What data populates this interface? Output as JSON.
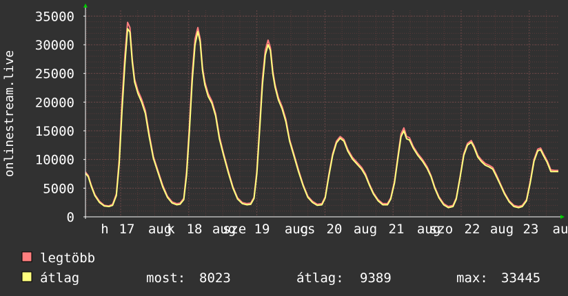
{
  "chart_data": {
    "type": "line",
    "ylabel": "onlinestream.live",
    "ylim": [
      0,
      36000
    ],
    "y_ticks": [
      0,
      5000,
      10000,
      15000,
      20000,
      25000,
      30000,
      35000
    ],
    "x_tick_labels": [
      "h",
      "17",
      "aug",
      "k",
      "18",
      "aug",
      "sze",
      "19",
      "aug",
      "cs",
      "20",
      "aug",
      "21",
      "aug",
      "szo",
      "22",
      "aug",
      "23",
      "au"
    ],
    "grid": true,
    "colors": {
      "background": "#313131",
      "plot_background": "#313131",
      "grid_minor": "#5a3a3a",
      "grid_major": "#6a4848",
      "axis": "#ffffff",
      "arrow": "#00cc00",
      "max_series": "#ff7f7f",
      "avg_series": "#ffff7f"
    },
    "series": [
      {
        "name": "legtöbb",
        "points": [
          [
            0,
            7800
          ],
          [
            0.06,
            7200
          ],
          [
            0.12,
            5600
          ],
          [
            0.2,
            3900
          ],
          [
            0.3,
            2700
          ],
          [
            0.4,
            2000
          ],
          [
            0.5,
            1900
          ],
          [
            0.58,
            2200
          ],
          [
            0.66,
            4000
          ],
          [
            0.72,
            10000
          ],
          [
            0.78,
            20000
          ],
          [
            0.84,
            28000
          ],
          [
            0.9,
            33900
          ],
          [
            0.95,
            33000
          ],
          [
            1.0,
            27500
          ],
          [
            1.05,
            24000
          ],
          [
            1.12,
            22000
          ],
          [
            1.2,
            20500
          ],
          [
            1.28,
            18500
          ],
          [
            1.36,
            14500
          ],
          [
            1.45,
            10500
          ],
          [
            1.55,
            8000
          ],
          [
            1.65,
            5500
          ],
          [
            1.75,
            3600
          ],
          [
            1.85,
            2600
          ],
          [
            1.95,
            2300
          ],
          [
            2.02,
            2400
          ],
          [
            2.1,
            3200
          ],
          [
            2.16,
            8000
          ],
          [
            2.22,
            16000
          ],
          [
            2.28,
            25000
          ],
          [
            2.34,
            31000
          ],
          [
            2.4,
            33000
          ],
          [
            2.45,
            31000
          ],
          [
            2.5,
            26000
          ],
          [
            2.55,
            23500
          ],
          [
            2.62,
            21500
          ],
          [
            2.7,
            20200
          ],
          [
            2.78,
            18000
          ],
          [
            2.86,
            14000
          ],
          [
            2.95,
            11000
          ],
          [
            3.05,
            8000
          ],
          [
            3.15,
            5200
          ],
          [
            3.25,
            3300
          ],
          [
            3.35,
            2500
          ],
          [
            3.45,
            2300
          ],
          [
            3.53,
            2400
          ],
          [
            3.6,
            3400
          ],
          [
            3.66,
            8000
          ],
          [
            3.72,
            16000
          ],
          [
            3.78,
            24000
          ],
          [
            3.84,
            29000
          ],
          [
            3.9,
            30800
          ],
          [
            3.95,
            29500
          ],
          [
            4.0,
            25500
          ],
          [
            4.05,
            23000
          ],
          [
            4.12,
            20800
          ],
          [
            4.2,
            19200
          ],
          [
            4.28,
            17000
          ],
          [
            4.36,
            13500
          ],
          [
            4.45,
            11000
          ],
          [
            4.55,
            8200
          ],
          [
            4.65,
            5600
          ],
          [
            4.75,
            3600
          ],
          [
            4.85,
            2700
          ],
          [
            4.95,
            2200
          ],
          [
            5.05,
            2300
          ],
          [
            5.12,
            3500
          ],
          [
            5.2,
            7500
          ],
          [
            5.28,
            11000
          ],
          [
            5.36,
            13200
          ],
          [
            5.44,
            14000
          ],
          [
            5.52,
            13500
          ],
          [
            5.6,
            11800
          ],
          [
            5.7,
            10400
          ],
          [
            5.8,
            9500
          ],
          [
            5.9,
            8600
          ],
          [
            5.98,
            7500
          ],
          [
            6.06,
            5800
          ],
          [
            6.15,
            4200
          ],
          [
            6.25,
            3000
          ],
          [
            6.35,
            2300
          ],
          [
            6.45,
            2300
          ],
          [
            6.52,
            3300
          ],
          [
            6.6,
            6200
          ],
          [
            6.68,
            11000
          ],
          [
            6.74,
            14500
          ],
          [
            6.8,
            15500
          ],
          [
            6.86,
            14000
          ],
          [
            6.92,
            13800
          ],
          [
            7.0,
            12300
          ],
          [
            7.1,
            11000
          ],
          [
            7.2,
            10000
          ],
          [
            7.3,
            8700
          ],
          [
            7.38,
            7200
          ],
          [
            7.46,
            5200
          ],
          [
            7.55,
            3500
          ],
          [
            7.65,
            2300
          ],
          [
            7.75,
            1800
          ],
          [
            7.85,
            2000
          ],
          [
            7.92,
            3300
          ],
          [
            8.0,
            7000
          ],
          [
            8.08,
            11000
          ],
          [
            8.16,
            12800
          ],
          [
            8.24,
            13300
          ],
          [
            8.3,
            12400
          ],
          [
            8.38,
            10700
          ],
          [
            8.46,
            9900
          ],
          [
            8.54,
            9300
          ],
          [
            8.62,
            9000
          ],
          [
            8.7,
            8600
          ],
          [
            8.78,
            7300
          ],
          [
            8.86,
            5800
          ],
          [
            8.95,
            4200
          ],
          [
            9.05,
            2800
          ],
          [
            9.15,
            2000
          ],
          [
            9.25,
            1800
          ],
          [
            9.33,
            2000
          ],
          [
            9.42,
            3000
          ],
          [
            9.5,
            6200
          ],
          [
            9.58,
            10000
          ],
          [
            9.66,
            11800
          ],
          [
            9.72,
            12000
          ],
          [
            9.78,
            11000
          ],
          [
            9.86,
            9800
          ],
          [
            9.94,
            8200
          ],
          [
            10.02,
            8100
          ],
          [
            10.1,
            8100
          ]
        ]
      },
      {
        "name": "átlag",
        "points": [
          [
            0,
            7600
          ],
          [
            0.06,
            7000
          ],
          [
            0.12,
            5400
          ],
          [
            0.2,
            3700
          ],
          [
            0.3,
            2500
          ],
          [
            0.4,
            1900
          ],
          [
            0.5,
            1800
          ],
          [
            0.58,
            2000
          ],
          [
            0.66,
            3700
          ],
          [
            0.72,
            9200
          ],
          [
            0.78,
            18500
          ],
          [
            0.84,
            26500
          ],
          [
            0.9,
            32800
          ],
          [
            0.95,
            32200
          ],
          [
            1.0,
            27000
          ],
          [
            1.05,
            23500
          ],
          [
            1.12,
            21500
          ],
          [
            1.2,
            20000
          ],
          [
            1.28,
            18000
          ],
          [
            1.36,
            14000
          ],
          [
            1.45,
            10200
          ],
          [
            1.55,
            7700
          ],
          [
            1.65,
            5200
          ],
          [
            1.75,
            3400
          ],
          [
            1.85,
            2400
          ],
          [
            1.95,
            2100
          ],
          [
            2.02,
            2200
          ],
          [
            2.1,
            3000
          ],
          [
            2.16,
            7300
          ],
          [
            2.22,
            15000
          ],
          [
            2.28,
            23800
          ],
          [
            2.34,
            30000
          ],
          [
            2.4,
            32300
          ],
          [
            2.45,
            30500
          ],
          [
            2.5,
            25500
          ],
          [
            2.55,
            23000
          ],
          [
            2.62,
            21000
          ],
          [
            2.7,
            19800
          ],
          [
            2.78,
            17600
          ],
          [
            2.86,
            13600
          ],
          [
            2.95,
            10700
          ],
          [
            3.05,
            7700
          ],
          [
            3.15,
            5000
          ],
          [
            3.25,
            3100
          ],
          [
            3.35,
            2300
          ],
          [
            3.45,
            2100
          ],
          [
            3.53,
            2200
          ],
          [
            3.6,
            3200
          ],
          [
            3.66,
            7500
          ],
          [
            3.72,
            15200
          ],
          [
            3.78,
            23000
          ],
          [
            3.84,
            28200
          ],
          [
            3.9,
            30000
          ],
          [
            3.95,
            29000
          ],
          [
            4.0,
            25000
          ],
          [
            4.05,
            22600
          ],
          [
            4.12,
            20400
          ],
          [
            4.2,
            18800
          ],
          [
            4.28,
            16600
          ],
          [
            4.36,
            13200
          ],
          [
            4.45,
            10700
          ],
          [
            4.55,
            7900
          ],
          [
            4.65,
            5400
          ],
          [
            4.75,
            3400
          ],
          [
            4.85,
            2500
          ],
          [
            4.95,
            2000
          ],
          [
            5.05,
            2100
          ],
          [
            5.12,
            3300
          ],
          [
            5.2,
            7200
          ],
          [
            5.28,
            10700
          ],
          [
            5.36,
            12900
          ],
          [
            5.44,
            13700
          ],
          [
            5.52,
            13200
          ],
          [
            5.6,
            11500
          ],
          [
            5.7,
            10100
          ],
          [
            5.8,
            9200
          ],
          [
            5.9,
            8300
          ],
          [
            5.98,
            7200
          ],
          [
            6.06,
            5600
          ],
          [
            6.15,
            4000
          ],
          [
            6.25,
            2800
          ],
          [
            6.35,
            2100
          ],
          [
            6.45,
            2100
          ],
          [
            6.52,
            3100
          ],
          [
            6.6,
            5900
          ],
          [
            6.68,
            10600
          ],
          [
            6.74,
            14000
          ],
          [
            6.8,
            15000
          ],
          [
            6.86,
            13600
          ],
          [
            6.92,
            13400
          ],
          [
            7.0,
            12000
          ],
          [
            7.1,
            10700
          ],
          [
            7.2,
            9700
          ],
          [
            7.3,
            8400
          ],
          [
            7.38,
            7000
          ],
          [
            7.46,
            5000
          ],
          [
            7.55,
            3300
          ],
          [
            7.65,
            2100
          ],
          [
            7.75,
            1600
          ],
          [
            7.85,
            1800
          ],
          [
            7.92,
            3100
          ],
          [
            8.0,
            6800
          ],
          [
            8.08,
            10700
          ],
          [
            8.16,
            12500
          ],
          [
            8.24,
            13000
          ],
          [
            8.3,
            12100
          ],
          [
            8.38,
            10400
          ],
          [
            8.46,
            9600
          ],
          [
            8.54,
            9000
          ],
          [
            8.62,
            8700
          ],
          [
            8.7,
            8300
          ],
          [
            8.78,
            7000
          ],
          [
            8.86,
            5600
          ],
          [
            8.95,
            4000
          ],
          [
            9.05,
            2600
          ],
          [
            9.15,
            1800
          ],
          [
            9.25,
            1600
          ],
          [
            9.33,
            1800
          ],
          [
            9.42,
            2800
          ],
          [
            9.5,
            5900
          ],
          [
            9.58,
            9700
          ],
          [
            9.66,
            11500
          ],
          [
            9.72,
            11700
          ],
          [
            9.78,
            10700
          ],
          [
            9.86,
            9500
          ],
          [
            9.94,
            7900
          ],
          [
            10.02,
            7900
          ],
          [
            10.1,
            7900
          ]
        ]
      }
    ],
    "legend": {
      "placement": "bottom-left",
      "items": [
        {
          "name": "legtöbb",
          "color": "#ff7f7f"
        },
        {
          "name": "átlag",
          "color": "#ffff7f"
        }
      ],
      "stats": {
        "most_label": "most:",
        "most_value": "8023",
        "atlag_label": "átlag:",
        "atlag_value": "9389",
        "max_label": "max:",
        "max_value": "33445"
      }
    }
  }
}
